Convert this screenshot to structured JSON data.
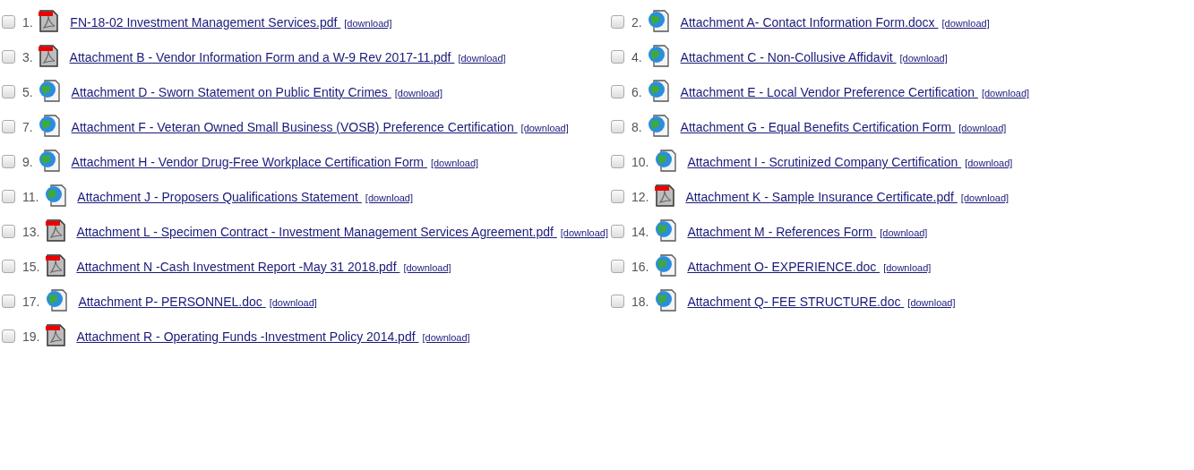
{
  "files": [
    {
      "number": "1.",
      "kind": "pdf",
      "checked": false,
      "name": "FN-18-02 Investment Management Services.pdf ",
      "download": "[download]"
    },
    {
      "number": "2.",
      "kind": "doc",
      "checked": false,
      "name": "Attachment A- Contact Information Form.docx ",
      "download": "[download]"
    },
    {
      "number": "3.",
      "kind": "pdf",
      "checked": false,
      "name": "Attachment B - Vendor Information Form and a W-9 Rev 2017-11.pdf ",
      "download": "[download]"
    },
    {
      "number": "4.",
      "kind": "doc",
      "checked": false,
      "name": "Attachment C - Non-Collusive Affidavit ",
      "download": "[download]"
    },
    {
      "number": "5.",
      "kind": "doc",
      "checked": false,
      "name": "Attachment D - Sworn Statement on Public Entity Crimes ",
      "download": "[download]"
    },
    {
      "number": "6.",
      "kind": "doc",
      "checked": false,
      "name": "Attachment E - Local Vendor Preference Certification ",
      "download": "[download]"
    },
    {
      "number": "7.",
      "kind": "doc",
      "checked": false,
      "name": "Attachment F - Veteran Owned Small Business (VOSB) Preference Certification ",
      "download": "[download]"
    },
    {
      "number": "8.",
      "kind": "doc",
      "checked": false,
      "name": "Attachment G - Equal Benefits Certification Form ",
      "download": "[download]"
    },
    {
      "number": "9.",
      "kind": "doc",
      "checked": false,
      "name": "Attachment H - Vendor Drug-Free Workplace Certification Form ",
      "download": "[download]"
    },
    {
      "number": "10.",
      "kind": "doc",
      "checked": false,
      "name": "Attachment I - Scrutinized Company Certification ",
      "download": "[download]"
    },
    {
      "number": "11.",
      "kind": "doc",
      "checked": false,
      "name": "Attachment J - Proposers Qualifications Statement ",
      "download": "[download]"
    },
    {
      "number": "12.",
      "kind": "pdf",
      "checked": false,
      "name": "Attachment K - Sample Insurance Certificate.pdf ",
      "download": "[download]"
    },
    {
      "number": "13.",
      "kind": "pdf",
      "checked": false,
      "name": "Attachment L - Specimen Contract - Investment Management Services Agreement.pdf ",
      "download": "[download]"
    },
    {
      "number": "14.",
      "kind": "doc",
      "checked": false,
      "name": "Attachment M - References Form ",
      "download": "[download]"
    },
    {
      "number": "15.",
      "kind": "pdf",
      "checked": false,
      "name": "Attachment N -Cash Investment Report -May 31 2018.pdf ",
      "download": "[download]"
    },
    {
      "number": "16.",
      "kind": "doc",
      "checked": false,
      "name": "Attachment O- EXPERIENCE.doc ",
      "download": "[download]"
    },
    {
      "number": "17.",
      "kind": "doc",
      "checked": false,
      "name": "Attachment P- PERSONNEL.doc ",
      "download": "[download]"
    },
    {
      "number": "18.",
      "kind": "doc",
      "checked": false,
      "name": "Attachment Q- FEE STRUCTURE.doc ",
      "download": "[download]"
    },
    {
      "number": "19.",
      "kind": "pdf",
      "checked": false,
      "name": "Attachment R - Operating Funds -Investment Policy 2014.pdf ",
      "download": "[download]"
    }
  ]
}
